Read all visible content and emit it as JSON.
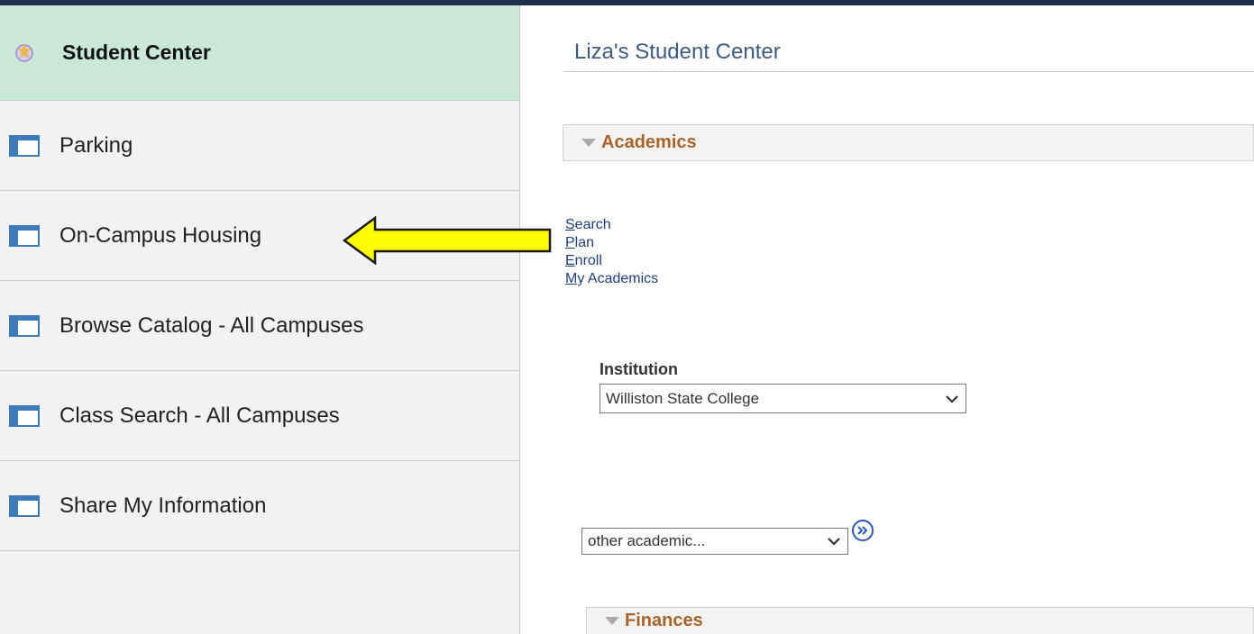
{
  "sidebar": {
    "header": {
      "label": "Student Center",
      "icon": "student-center-icon"
    },
    "items": [
      {
        "label": "Parking",
        "icon": "page-icon"
      },
      {
        "label": "On-Campus Housing",
        "icon": "page-icon"
      },
      {
        "label": "Browse Catalog - All Campuses",
        "icon": "page-icon"
      },
      {
        "label": "Class Search - All Campuses",
        "icon": "page-icon"
      },
      {
        "label": "Share My Information",
        "icon": "page-icon"
      }
    ]
  },
  "main": {
    "title": "Liza's Student Center",
    "academics": {
      "section_label": "Academics",
      "links": [
        {
          "accesskey": "S",
          "rest": "earch"
        },
        {
          "accesskey": "P",
          "rest": "lan"
        },
        {
          "accesskey": "E",
          "rest": "nroll"
        },
        {
          "accesskey": "M",
          "rest": "y Academics"
        }
      ],
      "institution_label": "Institution",
      "institution_value": "Williston State College",
      "other_academic_value": "other academic..."
    },
    "finances": {
      "section_label": "Finances"
    }
  },
  "colors": {
    "topbar": "#1d2f4a",
    "sidebar_header_bg": "#c9e8d8",
    "section_label": "#a8632a",
    "link": "#1f3f7a",
    "arrow_fill": "#ffff00"
  }
}
